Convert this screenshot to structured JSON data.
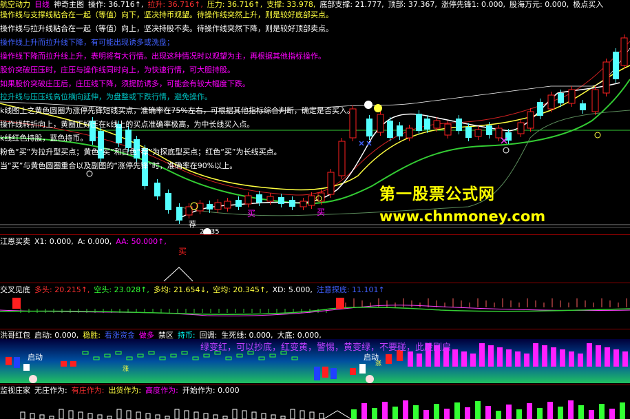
{
  "colors": {
    "bg": "#000000",
    "up": "#ff2020",
    "down": "#54ffff",
    "ma_white": "#ffffff",
    "ma_yellow": "#ffff40",
    "ma_green": "#33cc33",
    "divider": "#8a0000",
    "magenta": "#ff00ff",
    "cyan": "#00ffff"
  },
  "main_panel": {
    "header": {
      "app": "航空动力",
      "period": "日线",
      "indicator": "神奇主图",
      "op_label": "操作: 36.716↑,",
      "pull_label": "拉升: 36.716↑,",
      "pressure_label": "压力: 36.716↑,",
      "support_label": "支撑: 33.978,",
      "bottom_label": "底部支撑: 21.777,",
      "top_label": "顶部: 37.367,",
      "limit_label": "涨停先锋1: 0.000,",
      "wanyuan_label": "股海万元: 0.000,",
      "extreme_label": "极点买入"
    },
    "notes": [
      {
        "text": "操作线与支撑线粘合在一起（等值）向下，坚决持币观望。待操作线突然上升，则是较好底部买点。",
        "color": "#ffff40"
      },
      {
        "text": "操作线与拉升线粘合在一起（等值）向上，坚决持股不卖。待操作线突然下降，则是较好顶部卖点。",
        "color": "#ffffff"
      },
      {
        "text": "操作线上升而拉升线下降，有可能出现诱多或洗盘；",
        "color": "#4060ff"
      },
      {
        "text": "操作线下降而拉升线上升，表明将有大行情。出现这种情况时以观望为主，再根据其他指标操作。",
        "color": "#ff00ff"
      },
      {
        "text": "股价突破压压时，庄压与操作线同时向上，为快速行情，可大胆持股。",
        "color": "#ff00ff"
      },
      {
        "text": "如果股价突破庄压后，庄压线下降，须提防诱多，可能会有较大幅度下跌。",
        "color": "#ff00ff"
      },
      {
        "text": "拉升线与压压线高位横向延伸，为盘整或下跌行情，避免操作。",
        "color": "#00c0c0"
      },
      {
        "text": "k线图上之黄色圆圈为涨停先锋短线买点，准确率在75%左右，可根据其他指标综合判断，确定是否买入。",
        "color": "#ffffff"
      },
      {
        "text": "操作线转折向上，黄圈正好压在k线上的买点准确率极高，为中长线买入点。",
        "color": "#ffffff"
      },
      {
        "text": "k线红色持股，蓝色持币。",
        "color": "#ffffff"
      },
      {
        "text": "粉色“买”为拉升型买点；黄色“买”和白色“荐”为探底型买点；红色“买”为长线买点。",
        "color": "#ffffff"
      },
      {
        "text": "当“买”与黄色圆圈重合以及副图的“涨停先锋”时，准确率在90%以上。",
        "color": "#ffffff"
      }
    ],
    "markers": {
      "buy1": "买",
      "buy2": "买",
      "jian": "荐",
      "low_price": "20.35"
    },
    "watermark_cn": "第一股票公式网",
    "watermark_url": "www.chnmoney.com"
  },
  "panel_jiangen": {
    "title": "江恩买卖",
    "x1_label": "X1: 0.000,",
    "a_label": "A: 0.000,",
    "aa_label": "AA: 50.000↑,",
    "buy": "买"
  },
  "panel_jiaocha": {
    "title": "交叉见底",
    "duo_label": "多头: 20.215↑,",
    "kong_label": "空头: 23.028↑,",
    "duojun_label": "多均: 21.654↓,",
    "kongjun_label": "空均: 20.345↑,",
    "xd_label": "XD: 5.000,",
    "tanbao_label": "注意探底: 11.101↑"
  },
  "panel_honggehong": {
    "title": "洪哥红包",
    "qidong_label": "启动: 0.000,",
    "wensheng_label": "稳胜:",
    "youtui_label": "看涨资金",
    "zuoduo_label": "做多",
    "jinqu_label": "禁区",
    "chibi_label": "持币:",
    "huice_label": "回调:",
    "shengsi_label": "生死线: 0.000,",
    "dadie_label": "大底: 0.000,",
    "slogan": "绿变红，可以抄底，红变黄，警惕，黄变绿，不要碰，此股刚启",
    "start1": "启动",
    "start2": "启动",
    "up1": "涨",
    "up2": "涨"
  },
  "panel_jiankong": {
    "title": "监视庄家",
    "wuzhuang_label": "无庄作为:",
    "youzhuang_label": "有庄作为:",
    "chuhuo_label": "出货作为:",
    "gaodu_label": "高度作为:",
    "kaishi_label": "开始作为: 0.000"
  }
}
